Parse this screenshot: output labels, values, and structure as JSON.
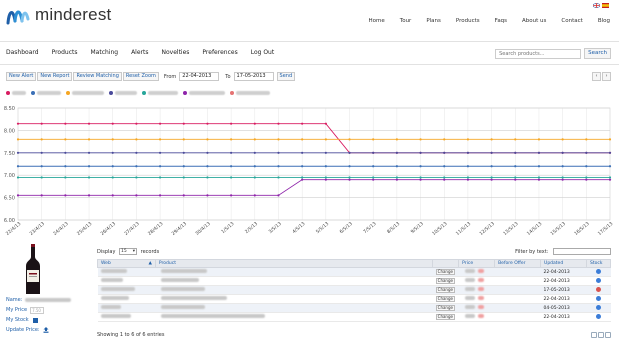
{
  "brand": {
    "name": "minderest"
  },
  "top_nav": [
    "Home",
    "Tour",
    "Plans",
    "Products",
    "Faqs",
    "About us",
    "Contact",
    "Blog"
  ],
  "main_nav": [
    "Dashboard",
    "Products",
    "Matching",
    "Alerts",
    "Novelties",
    "Preferences",
    "Log Out"
  ],
  "search": {
    "placeholder": "Search products...",
    "button": "Search"
  },
  "toolbar": {
    "buttons": [
      "New Alert",
      "New Report",
      "Review Matching",
      "Reset Zoom"
    ],
    "from_label": "From",
    "from_value": "22-04-2013",
    "to_label": "To",
    "to_value": "17-05-2013",
    "send": "Send"
  },
  "pager_icons": [
    "chevron-left-icon",
    "chevron-right-icon"
  ],
  "chart_data": {
    "type": "line",
    "x": [
      "22/4/13",
      "23/4/13",
      "24/4/13",
      "25/4/13",
      "26/4/13",
      "27/4/13",
      "28/4/13",
      "29/4/13",
      "30/4/13",
      "1/5/13",
      "2/5/13",
      "3/5/13",
      "4/5/13",
      "5/5/13",
      "6/5/13",
      "7/5/13",
      "8/5/13",
      "9/5/13",
      "10/5/13",
      "11/5/13",
      "12/5/13",
      "13/5/13",
      "14/5/13",
      "15/5/13",
      "16/5/13",
      "17/5/13"
    ],
    "ylim": [
      6.0,
      8.5
    ],
    "yticks": [
      "6.00",
      "6.50",
      "7.00",
      "7.50",
      "8.00",
      "8.50"
    ],
    "legend_position": "top-left",
    "series": [
      {
        "color": "#d81b60",
        "values": [
          8.15,
          8.15,
          8.15,
          8.15,
          8.15,
          8.15,
          8.15,
          8.15,
          8.15,
          8.15,
          8.15,
          8.15,
          8.15,
          8.15,
          7.5,
          7.5,
          7.5,
          7.5,
          7.5,
          7.5,
          7.5,
          7.5,
          7.5,
          7.5,
          7.5,
          7.5
        ]
      },
      {
        "color": "#f5a623",
        "values": [
          7.8,
          7.8,
          7.8,
          7.8,
          7.8,
          7.8,
          7.8,
          7.8,
          7.8,
          7.8,
          7.8,
          7.8,
          7.8,
          7.8,
          7.8,
          7.8,
          7.8,
          7.8,
          7.8,
          7.8,
          7.8,
          7.8,
          7.8,
          7.8,
          7.8,
          7.8
        ]
      },
      {
        "color": "#4a4a9a",
        "values": [
          7.5,
          7.5,
          7.5,
          7.5,
          7.5,
          7.5,
          7.5,
          7.5,
          7.5,
          7.5,
          7.5,
          7.5,
          7.5,
          7.5,
          7.5,
          7.5,
          7.5,
          7.5,
          7.5,
          7.5,
          7.5,
          7.5,
          7.5,
          7.5,
          7.5,
          7.5
        ]
      },
      {
        "color": "#3b6fb6",
        "values": [
          7.2,
          7.2,
          7.2,
          7.2,
          7.2,
          7.2,
          7.2,
          7.2,
          7.2,
          7.2,
          7.2,
          7.2,
          7.2,
          7.2,
          7.2,
          7.2,
          7.2,
          7.2,
          7.2,
          7.2,
          7.2,
          7.2,
          7.2,
          7.2,
          7.2,
          7.2
        ]
      },
      {
        "color": "#26a69a",
        "values": [
          6.95,
          6.95,
          6.95,
          6.95,
          6.95,
          6.95,
          6.95,
          6.95,
          6.95,
          6.95,
          6.95,
          6.95,
          6.95,
          6.95,
          6.95,
          6.95,
          6.95,
          6.95,
          6.95,
          6.95,
          6.95,
          6.95,
          6.95,
          6.95,
          6.95,
          6.95
        ]
      },
      {
        "color": "#8e24aa",
        "values": [
          6.55,
          6.55,
          6.55,
          6.55,
          6.55,
          6.55,
          6.55,
          6.55,
          6.55,
          6.55,
          6.55,
          6.55,
          6.9,
          6.9,
          6.9,
          6.9,
          6.9,
          6.9,
          6.9,
          6.9,
          6.9,
          6.9,
          6.9,
          6.9,
          6.9,
          6.9
        ]
      }
    ]
  },
  "product": {
    "name_label": "Name:",
    "price_label": "My Price",
    "stock_label": "My Stock",
    "update_label": "Update Price:"
  },
  "table": {
    "display_label": "Display",
    "display_value": "15",
    "records_label": "records",
    "filter_label": "Filter by text:",
    "headers": [
      "Web",
      "Product",
      "",
      "Price",
      "Before Offer",
      "Updated",
      "Stock"
    ],
    "rows": [
      {
        "change": "Change",
        "updated": "22-04-2013",
        "stock_color": "#3b7dd8"
      },
      {
        "change": "Change",
        "updated": "22-04-2013",
        "stock_color": "#3b7dd8"
      },
      {
        "change": "Change",
        "updated": "17-05-2013",
        "stock_color": "#d9534f"
      },
      {
        "change": "Change",
        "updated": "22-04-2013",
        "stock_color": "#3b7dd8"
      },
      {
        "change": "Change",
        "updated": "04-05-2013",
        "stock_color": "#3b7dd8"
      },
      {
        "change": "Change",
        "updated": "22-04-2013",
        "stock_color": "#3b7dd8"
      }
    ],
    "footer": "Showing 1 to 6 of 6 entries"
  }
}
